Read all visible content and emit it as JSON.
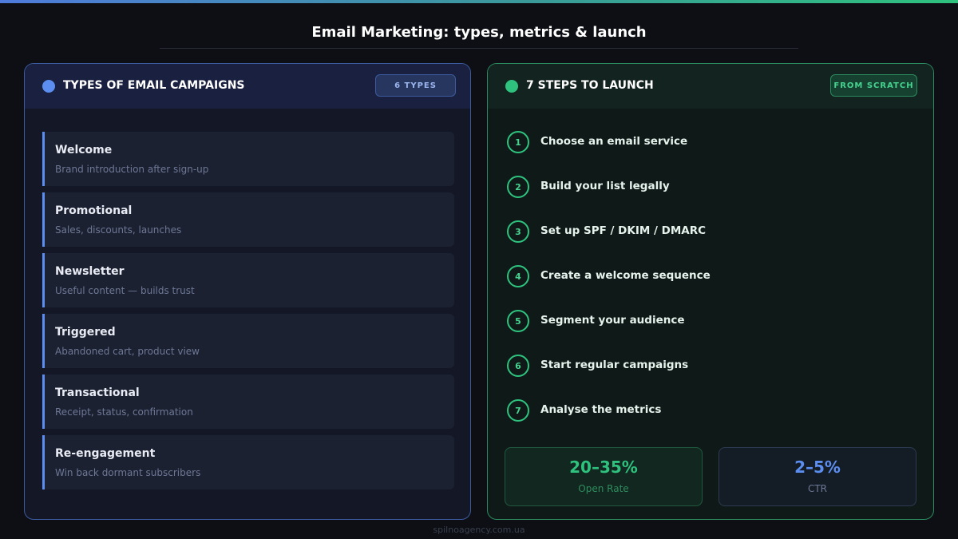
{
  "title": "Email Marketing: types, metrics & launch",
  "types_panel": {
    "heading": "TYPES OF EMAIL CAMPAIGNS",
    "badge": "6 TYPES",
    "items": [
      {
        "name": "Welcome",
        "desc": "Brand introduction after sign-up"
      },
      {
        "name": "Promotional",
        "desc": "Sales, discounts, launches"
      },
      {
        "name": "Newsletter",
        "desc": "Useful content — builds trust"
      },
      {
        "name": "Triggered",
        "desc": "Abandoned cart, product view"
      },
      {
        "name": "Transactional",
        "desc": "Receipt, status, confirmation"
      },
      {
        "name": "Re-engagement",
        "desc": "Win back dormant subscribers"
      }
    ]
  },
  "steps_panel": {
    "heading": "7 STEPS TO LAUNCH",
    "badge": "FROM SCRATCH",
    "steps": [
      {
        "num": "1",
        "label": "Choose an email service"
      },
      {
        "num": "2",
        "label": "Build your list legally"
      },
      {
        "num": "3",
        "label": "Set up SPF / DKIM / DMARC"
      },
      {
        "num": "4",
        "label": "Create a welcome sequence"
      },
      {
        "num": "5",
        "label": "Segment your audience"
      },
      {
        "num": "6",
        "label": "Start regular campaigns"
      },
      {
        "num": "7",
        "label": "Analyse the metrics"
      }
    ],
    "metrics": [
      {
        "value": "20–35%",
        "label": "Open Rate"
      },
      {
        "value": "2–5%",
        "label": "CTR"
      }
    ]
  },
  "footer": "spilnoagency.com.ua",
  "colors": {
    "accent_blue": "#5b8ef0",
    "accent_green": "#2ec27e",
    "background": "#0d0f15"
  }
}
